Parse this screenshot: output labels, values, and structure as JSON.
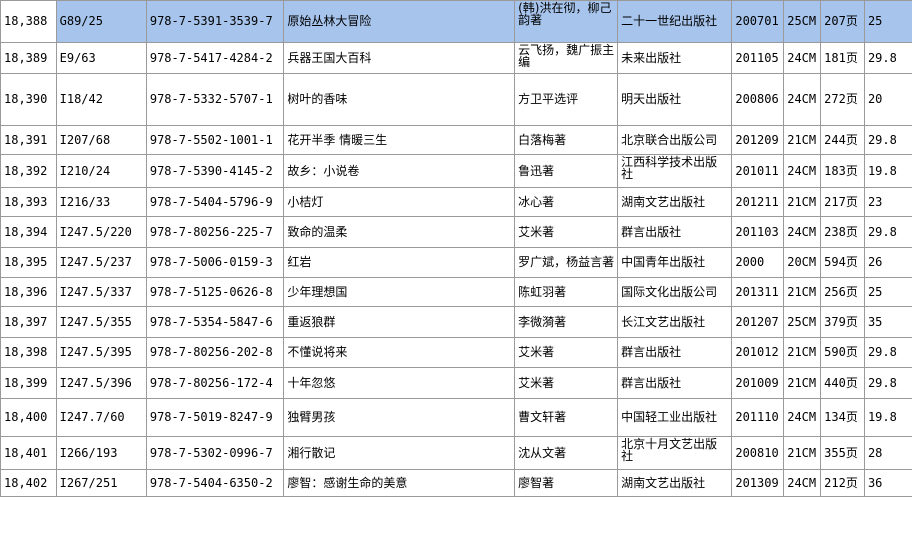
{
  "rows": [
    {
      "id": "18,388",
      "call": "G89/25",
      "isbn": "978-7-5391-3539-7",
      "title": "原始丛林大冒险",
      "author": "(韩)洪在彻，柳己韵著",
      "publisher": "二十一世纪出版社",
      "date": "200701",
      "size": "25CM",
      "pages": "207页",
      "price": "25",
      "selected": true
    },
    {
      "id": "18,389",
      "call": "E9/63",
      "isbn": "978-7-5417-4284-2",
      "title": "兵器王国大百科",
      "author": "云飞扬，魏广振主编",
      "publisher": "未来出版社",
      "date": "201105",
      "size": "24CM",
      "pages": "181页",
      "price": "29.8",
      "selected": false
    },
    {
      "id": "18,390",
      "call": "I18/42",
      "isbn": "978-7-5332-5707-1",
      "title": "树叶的香味",
      "author": "方卫平选评",
      "publisher": "明天出版社",
      "date": "200806",
      "size": "24CM",
      "pages": "272页",
      "price": "20",
      "selected": false
    },
    {
      "id": "18,391",
      "call": "I207/68",
      "isbn": "978-7-5502-1001-1",
      "title": "花开半季 情暖三生",
      "author": "白落梅著",
      "publisher": "北京联合出版公司",
      "date": "201209",
      "size": "21CM",
      "pages": "244页",
      "price": "29.8",
      "selected": false
    },
    {
      "id": "18,392",
      "call": "I210/24",
      "isbn": "978-7-5390-4145-2",
      "title": "故乡：小说卷",
      "author": "鲁迅著",
      "publisher": "江西科学技术出版社",
      "date": "201011",
      "size": "24CM",
      "pages": "183页",
      "price": "19.8",
      "selected": false
    },
    {
      "id": "18,393",
      "call": "I216/33",
      "isbn": "978-7-5404-5796-9",
      "title": "小桔灯",
      "author": "冰心著",
      "publisher": "湖南文艺出版社",
      "date": "201211",
      "size": "21CM",
      "pages": "217页",
      "price": "23",
      "selected": false
    },
    {
      "id": "18,394",
      "call": "I247.5/220",
      "isbn": "978-7-80256-225-7",
      "title": "致命的温柔",
      "author": "艾米著",
      "publisher": "群言出版社",
      "date": "201103",
      "size": "24CM",
      "pages": "238页",
      "price": "29.8",
      "selected": false
    },
    {
      "id": "18,395",
      "call": "I247.5/237",
      "isbn": "978-7-5006-0159-3",
      "title": "红岩",
      "author": "罗广斌，杨益言著",
      "publisher": "中国青年出版社",
      "date": "2000",
      "size": "20CM",
      "pages": "594页",
      "price": "26",
      "selected": false
    },
    {
      "id": "18,396",
      "call": "I247.5/337",
      "isbn": "978-7-5125-0626-8",
      "title": "少年理想国",
      "author": "陈虹羽著",
      "publisher": "国际文化出版公司",
      "date": "201311",
      "size": "21CM",
      "pages": "256页",
      "price": "25",
      "selected": false
    },
    {
      "id": "18,397",
      "call": "I247.5/355",
      "isbn": "978-7-5354-5847-6",
      "title": "重返狼群",
      "author": "李微漪著",
      "publisher": "长江文艺出版社",
      "date": "201207",
      "size": "25CM",
      "pages": "379页",
      "price": "35",
      "selected": false
    },
    {
      "id": "18,398",
      "call": "I247.5/395",
      "isbn": "978-7-80256-202-8",
      "title": "不懂说将来",
      "author": "艾米著",
      "publisher": "群言出版社",
      "date": "201012",
      "size": "21CM",
      "pages": "590页",
      "price": "29.8",
      "selected": false
    },
    {
      "id": "18,399",
      "call": "I247.5/396",
      "isbn": "978-7-80256-172-4",
      "title": "十年忽悠",
      "author": "艾米著",
      "publisher": "群言出版社",
      "date": "201009",
      "size": "21CM",
      "pages": "440页",
      "price": "29.8",
      "selected": false
    },
    {
      "id": "18,400",
      "call": "I247.7/60",
      "isbn": "978-7-5019-8247-9",
      "title": "独臂男孩",
      "author": "曹文轩著",
      "publisher": "中国轻工业出版社",
      "date": "201110",
      "size": "24CM",
      "pages": "134页",
      "price": "19.8",
      "selected": false
    },
    {
      "id": "18,401",
      "call": "I266/193",
      "isbn": "978-7-5302-0996-7",
      "title": "湘行散记",
      "author": "沈从文著",
      "publisher": "北京十月文艺出版社",
      "date": "200810",
      "size": "21CM",
      "pages": "355页",
      "price": "28",
      "selected": false
    },
    {
      "id": "18,402",
      "call": "I267/251",
      "isbn": "978-7-5404-6350-2",
      "title": "廖智：感谢生命的美意",
      "author": "廖智著",
      "publisher": "湖南文艺出版社",
      "date": "201309",
      "size": "24CM",
      "pages": "212页",
      "price": "36",
      "selected": false
    }
  ]
}
